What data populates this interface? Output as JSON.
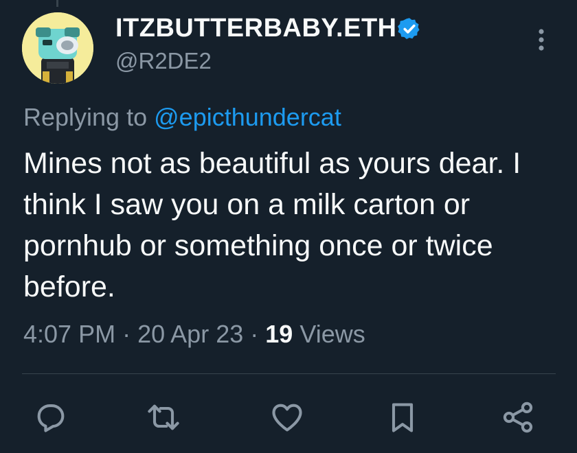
{
  "tweet": {
    "author": {
      "display_name": "ITZBUTTERBABY.ETH",
      "handle": "@R2DE2",
      "verified": true,
      "avatar_icon": "nft-avatar-icon"
    },
    "replying_to_prefix": "Replying to",
    "replying_to_handle": "@epicthundercat",
    "text": "Mines not as beautiful as yours dear. I think I saw you on a milk carton or pornhub or something once or twice before.",
    "time": "4:07 PM",
    "separator": "·",
    "date": "20 Apr 23",
    "views_count": "19",
    "views_label": "Views"
  },
  "actions": [
    {
      "icon": "reply-icon"
    },
    {
      "icon": "retweet-icon"
    },
    {
      "icon": "like-icon"
    },
    {
      "icon": "bookmark-icon"
    },
    {
      "icon": "share-icon"
    }
  ],
  "colors": {
    "background": "#15202b",
    "accent": "#1d9bf0",
    "text_primary": "#f7f9f9",
    "text_secondary": "#8b98a5",
    "divider": "#38444d"
  }
}
